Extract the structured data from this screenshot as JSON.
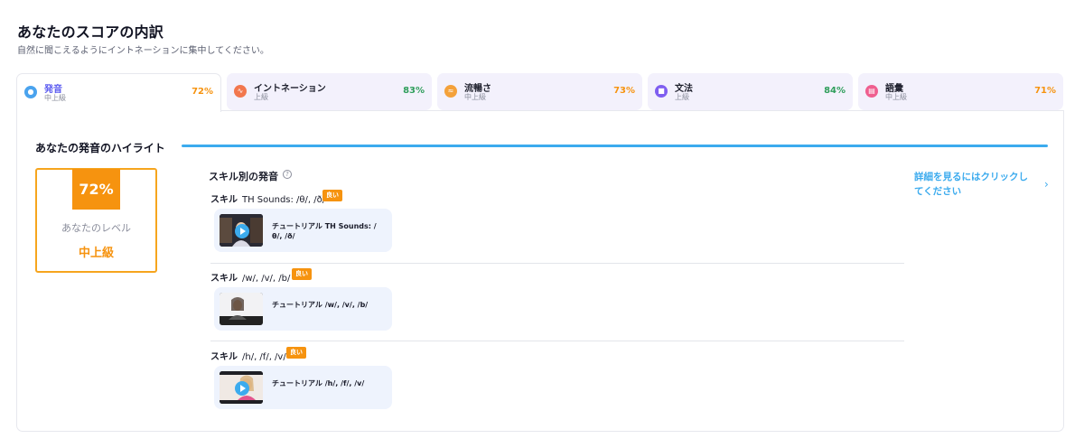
{
  "header": {
    "title": "あなたのスコアの内訳",
    "subtitle": "自然に聞こえるようにイントネーションに集中してください。"
  },
  "tabs": [
    {
      "name": "発音",
      "level": "中上級",
      "score": "72%",
      "icon": "microphone-icon",
      "icon_color": "#4aa3ee",
      "score_color": "#f6930f"
    },
    {
      "name": "イントネーション",
      "level": "上級",
      "score": "83%",
      "icon": "waveform-icon",
      "icon_color": "#f2774d",
      "score_color": "#2f9e5b"
    },
    {
      "name": "流暢さ",
      "level": "中上級",
      "score": "73%",
      "icon": "flow-icon",
      "icon_color": "#f4a13a",
      "score_color": "#f6930f"
    },
    {
      "name": "文法",
      "level": "上級",
      "score": "84%",
      "icon": "grammar-icon",
      "icon_color": "#7f5ef0",
      "score_color": "#2f9e5b"
    },
    {
      "name": "語彙",
      "level": "中上級",
      "score": "71%",
      "icon": "vocabulary-icon",
      "icon_color": "#ef5f8f",
      "score_color": "#f6930f"
    }
  ],
  "highlights": {
    "title": "あなたの発音のハイライト",
    "level_score": "72%",
    "level_label": "あなたのレベル",
    "level_value": "中上級"
  },
  "skills": {
    "title": "スキル別の発音",
    "items": [
      {
        "label": "スキル",
        "sound": "TH Sounds: /θ/, /ð/",
        "badge": "良い",
        "tutorial": "チュートリアル TH Sounds: /θ/, /ð/"
      },
      {
        "label": "スキル",
        "sound": "/w/, /v/, /b/",
        "badge": "良い",
        "tutorial": "チュートリアル /w/, /v/, /b/"
      },
      {
        "label": "スキル",
        "sound": "/h/, /f/, /v/",
        "badge": "良い",
        "tutorial": "チュートリアル /h/, /f/, /v/"
      }
    ]
  },
  "details_link": "詳細を見るにはクリックしてください",
  "colors": {
    "accent_blue": "#3cabee",
    "accent_orange": "#f6930f",
    "accent_green": "#2f9e5b",
    "active_tab_text": "#5b5bf0"
  }
}
